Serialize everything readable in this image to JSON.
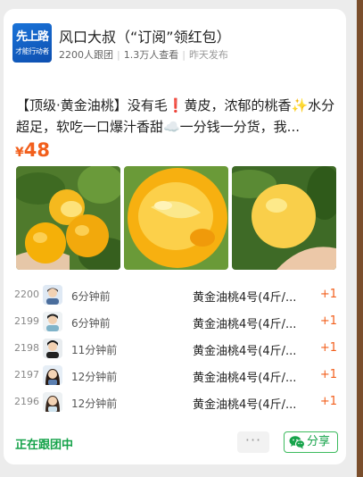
{
  "header": {
    "avatar_text_line1": "先上路",
    "avatar_text_line2": "才能行动者",
    "title": "风口大叔（“订阅”领红包）",
    "followers": "2200人跟团",
    "views": "1.3万人查看",
    "posted": "昨天发布"
  },
  "post": {
    "description": "【顶级·黄金油桃】没有毛❗黄皮，浓郁的桃香✨水分超足，软吃一口爆汁香甜☁️一分钱一分货，我...",
    "currency": "¥",
    "price": "48"
  },
  "orders": [
    {
      "no": "2200",
      "time": "6分钟前",
      "product": "黄金油桃4号(4斤/...",
      "qty": "+1"
    },
    {
      "no": "2199",
      "time": "6分钟前",
      "product": "黄金油桃4号(4斤/...",
      "qty": "+1"
    },
    {
      "no": "2198",
      "time": "11分钟前",
      "product": "黄金油桃4号(4斤/...",
      "qty": "+1"
    },
    {
      "no": "2197",
      "time": "12分钟前",
      "product": "黄金油桃4号(4斤/...",
      "qty": "+1"
    },
    {
      "no": "2196",
      "time": "12分钟前",
      "product": "黄金油桃4号(4斤/...",
      "qty": "+1"
    }
  ],
  "footer": {
    "status": "正在跟团中",
    "more": "···",
    "share": "分享"
  },
  "colors": {
    "price": "#f25f1c",
    "accent_green": "#16a34a",
    "avatar_blue": "#1a73d8"
  }
}
